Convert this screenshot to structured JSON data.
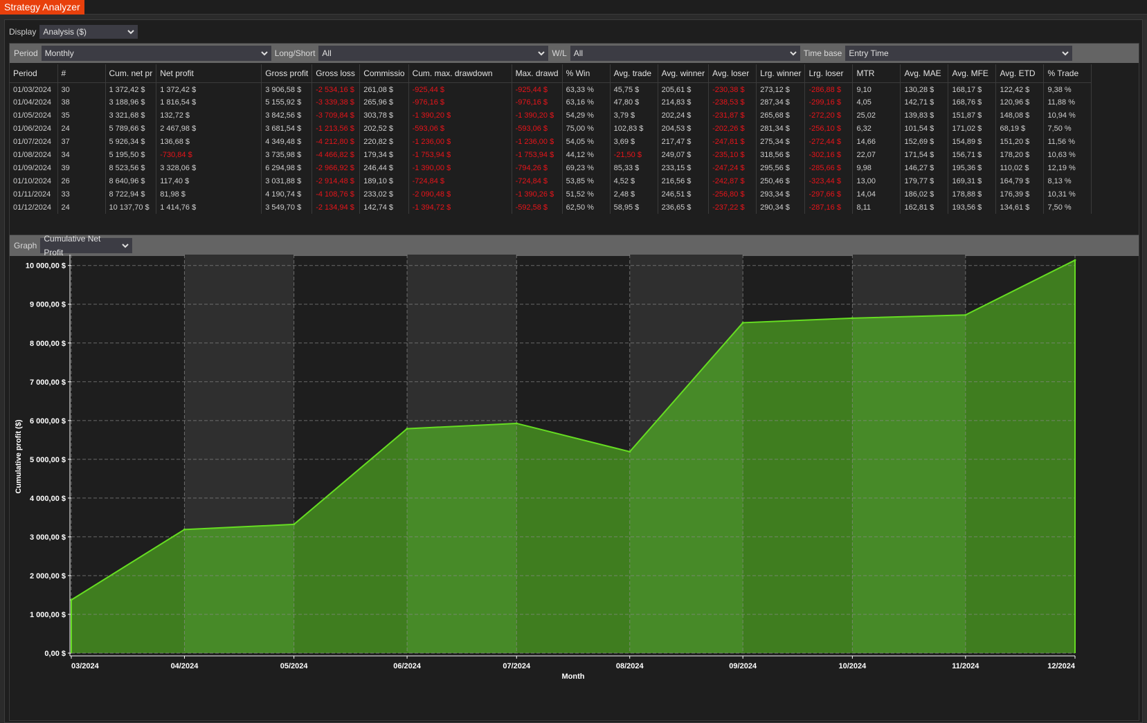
{
  "app": {
    "title": "Strategy Analyzer"
  },
  "display": {
    "label": "Display",
    "value": "Analysis ($)"
  },
  "filters": [
    {
      "label": "Period",
      "value": "Monthly"
    },
    {
      "label": "Long/Short",
      "value": "All"
    },
    {
      "label": "W/L",
      "value": "All"
    },
    {
      "label": "Time base",
      "value": "Entry Time"
    }
  ],
  "table": {
    "columns": [
      "Period",
      "#",
      "Cum. net pr",
      "Net profit",
      "Gross profit",
      "Gross loss",
      "Commissio",
      "Cum. max. drawdown",
      "Max. drawd",
      "% Win",
      "Avg. trade",
      "Avg. winner",
      "Avg. loser",
      "Lrg. winner",
      "Lrg. loser",
      "MTR",
      "Avg. MAE",
      "Avg. MFE",
      "Avg. ETD",
      "% Trade"
    ],
    "rows": [
      [
        "01/03/2024",
        "30",
        "1 372,42 $",
        "1 372,42 $",
        "3 906,58 $",
        "-2 534,16 $",
        "261,08 $",
        "-925,44 $",
        "-925,44 $",
        "63,33 %",
        "45,75 $",
        "205,61 $",
        "-230,38 $",
        "273,12 $",
        "-286,88 $",
        "9,10",
        "130,28 $",
        "168,17 $",
        "122,42 $",
        "9,38 %"
      ],
      [
        "01/04/2024",
        "38",
        "3 188,96 $",
        "1 816,54 $",
        "5 155,92 $",
        "-3 339,38 $",
        "265,96 $",
        "-976,16 $",
        "-976,16 $",
        "63,16 %",
        "47,80 $",
        "214,83 $",
        "-238,53 $",
        "287,34 $",
        "-299,16 $",
        "4,05",
        "142,71 $",
        "168,76 $",
        "120,96 $",
        "11,88 %"
      ],
      [
        "01/05/2024",
        "35",
        "3 321,68 $",
        "132,72 $",
        "3 842,56 $",
        "-3 709,84 $",
        "303,78 $",
        "-1 390,20 $",
        "-1 390,20 $",
        "54,29 %",
        "3,79 $",
        "202,24 $",
        "-231,87 $",
        "265,68 $",
        "-272,20 $",
        "25,02",
        "139,83 $",
        "151,87 $",
        "148,08 $",
        "10,94 %"
      ],
      [
        "01/06/2024",
        "24",
        "5 789,66 $",
        "2 467,98 $",
        "3 681,54 $",
        "-1 213,56 $",
        "202,52 $",
        "-593,06 $",
        "-593,06 $",
        "75,00 %",
        "102,83 $",
        "204,53 $",
        "-202,26 $",
        "281,34 $",
        "-256,10 $",
        "6,32",
        "101,54 $",
        "171,02 $",
        "68,19 $",
        "7,50 %"
      ],
      [
        "01/07/2024",
        "37",
        "5 926,34 $",
        "136,68 $",
        "4 349,48 $",
        "-4 212,80 $",
        "220,82 $",
        "-1 236,00 $",
        "-1 236,00 $",
        "54,05 %",
        "3,69 $",
        "217,47 $",
        "-247,81 $",
        "275,34 $",
        "-272,44 $",
        "14,66",
        "152,69 $",
        "154,89 $",
        "151,20 $",
        "11,56 %"
      ],
      [
        "01/08/2024",
        "34",
        "5 195,50 $",
        "-730,84 $",
        "3 735,98 $",
        "-4 466,82 $",
        "179,34 $",
        "-1 753,94 $",
        "-1 753,94 $",
        "44,12 %",
        "-21,50 $",
        "249,07 $",
        "-235,10 $",
        "318,56 $",
        "-302,16 $",
        "22,07",
        "171,54 $",
        "156,71 $",
        "178,20 $",
        "10,63 %"
      ],
      [
        "01/09/2024",
        "39",
        "8 523,56 $",
        "3 328,06 $",
        "6 294,98 $",
        "-2 966,92 $",
        "246,44 $",
        "-1 390,00 $",
        "-794,26 $",
        "69,23 %",
        "85,33 $",
        "233,15 $",
        "-247,24 $",
        "295,56 $",
        "-285,66 $",
        "9,98",
        "146,27 $",
        "195,36 $",
        "110,02 $",
        "12,19 %"
      ],
      [
        "01/10/2024",
        "26",
        "8 640,96 $",
        "117,40 $",
        "3 031,88 $",
        "-2 914,48 $",
        "189,10 $",
        "-724,84 $",
        "-724,84 $",
        "53,85 %",
        "4,52 $",
        "216,56 $",
        "-242,87 $",
        "250,46 $",
        "-323,44 $",
        "13,00",
        "179,77 $",
        "169,31 $",
        "164,79 $",
        "8,13 %"
      ],
      [
        "01/11/2024",
        "33",
        "8 722,94 $",
        "81,98 $",
        "4 190,74 $",
        "-4 108,76 $",
        "233,02 $",
        "-2 090,48 $",
        "-1 390,26 $",
        "51,52 %",
        "2,48 $",
        "246,51 $",
        "-256,80 $",
        "293,34 $",
        "-297,66 $",
        "14,04",
        "186,02 $",
        "178,88 $",
        "176,39 $",
        "10,31 %"
      ],
      [
        "01/12/2024",
        "24",
        "10 137,70 $",
        "1 414,76 $",
        "3 549,70 $",
        "-2 134,94 $",
        "142,74 $",
        "-1 394,72 $",
        "-592,58 $",
        "62,50 %",
        "58,95 $",
        "236,65 $",
        "-237,22 $",
        "290,34 $",
        "-287,16 $",
        "8,11",
        "162,81 $",
        "193,56 $",
        "134,61 $",
        "7,50 %"
      ]
    ]
  },
  "graph": {
    "label": "Graph",
    "value": "Cumulative Net Profit"
  },
  "colors": {
    "accent": "#e8400c",
    "negative": "#e8141a",
    "line": "#66dd22",
    "fill": "#3f7d1f",
    "fill_alt": "#478a28",
    "band_alt": "#2f2f2f"
  },
  "chart_data": {
    "type": "area",
    "title": "Cumulative Net Profit",
    "xlabel": "Month",
    "ylabel": "Cumulative profit ($)",
    "categories": [
      "03/2024",
      "04/2024",
      "05/2024",
      "06/2024",
      "07/2024",
      "08/2024",
      "09/2024",
      "10/2024",
      "11/2024",
      "12/2024"
    ],
    "day_offsets": [
      0,
      31,
      61,
      92,
      122,
      153,
      184,
      214,
      245,
      275
    ],
    "values": [
      1372.42,
      3188.96,
      3321.68,
      5789.66,
      5926.34,
      5195.5,
      8523.56,
      8640.96,
      8722.94,
      10137.7
    ],
    "ylim": [
      0,
      10137.7
    ],
    "yticks": [
      0,
      1000,
      2000,
      3000,
      4000,
      5000,
      6000,
      7000,
      8000,
      9000,
      10000
    ],
    "ytick_labels": [
      "0,00 $",
      "1 000,00 $",
      "2 000,00 $",
      "3 000,00 $",
      "4 000,00 $",
      "5 000,00 $",
      "6 000,00 $",
      "7 000,00 $",
      "8 000,00 $",
      "9 000,00 $",
      "10 000,00 $"
    ],
    "grid": true,
    "legend": "none"
  }
}
